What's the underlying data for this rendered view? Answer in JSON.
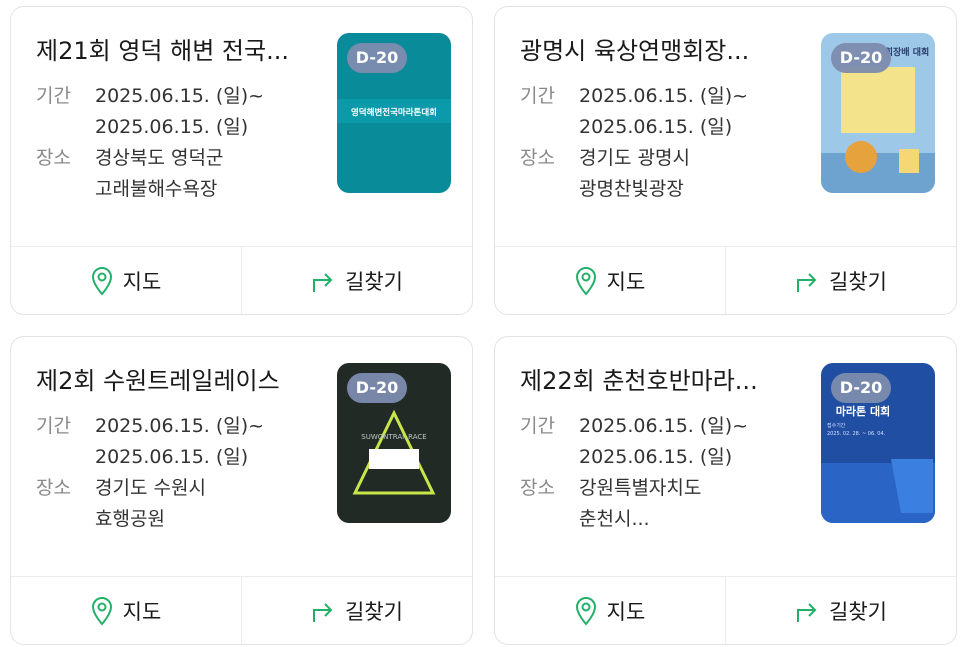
{
  "labels": {
    "period": "기간",
    "place": "장소",
    "map": "지도",
    "directions": "길찾기"
  },
  "colors": {
    "accent_green": "#23b069",
    "dday_badge": "#7d8caf"
  },
  "cards": [
    {
      "title": "제21회 영덕 해변 전국...",
      "period_start": "2025.06.15. (일)~",
      "period_end": "2025.06.15. (일)",
      "place_line1": "경상북도 영덕군",
      "place_line2": "고래불해수욕장",
      "dday": "D-20",
      "poster_text": "영덕해변전국마라톤대회",
      "poster_bg": "#0a8b9a"
    },
    {
      "title": "광명시 육상연맹회장...",
      "period_start": "2025.06.15. (일)~",
      "period_end": "2025.06.15. (일)",
      "place_line1": "경기도 광명시",
      "place_line2": "광명찬빛광장",
      "dday": "D-20",
      "poster_text": "회장배 대회",
      "poster_bg": "#9ec8e8"
    },
    {
      "title": "제2회 수원트레일레이스",
      "period_start": "2025.06.15. (일)~",
      "period_end": "2025.06.15. (일)",
      "place_line1": "경기도 수원시",
      "place_line2": "효행공원",
      "dday": "D-20",
      "poster_text": "SUWONTRAILRACE",
      "poster_bg": "#222a26"
    },
    {
      "title": "제22회 춘천호반마라...",
      "period_start": "2025.06.15. (일)~",
      "period_end": "2025.06.15. (일)",
      "place_line1": "강원특별자치도",
      "place_line2": "춘천시...",
      "dday": "D-20",
      "poster_text": "마라톤 대회",
      "poster_subtext": "접수기간",
      "poster_dates": "2025. 02. 28. ~ 06. 04.",
      "poster_bg": "#1f4ea3"
    }
  ]
}
